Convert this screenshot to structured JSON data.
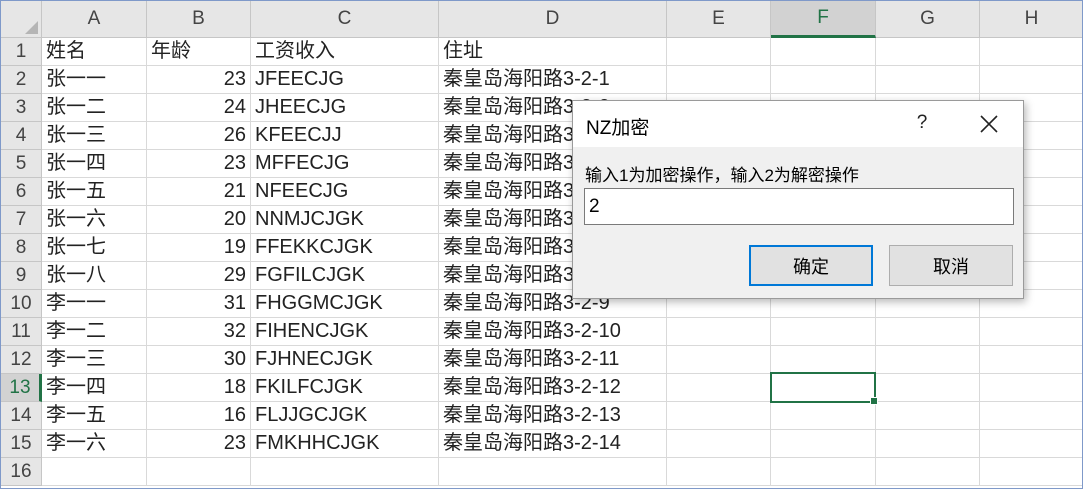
{
  "sheet": {
    "columns": [
      "A",
      "B",
      "C",
      "D",
      "E",
      "F",
      "G",
      "H"
    ],
    "selected_column": "F",
    "selected_row": "13",
    "rows": [
      {
        "num": "1",
        "cells": [
          "姓名",
          "年龄",
          "工资收入",
          "住址"
        ]
      },
      {
        "num": "2",
        "cells": [
          "张一一",
          "23",
          "JFEECJG",
          "秦皇岛海阳路3-2-1"
        ]
      },
      {
        "num": "3",
        "cells": [
          "张一二",
          "24",
          "JHEECJG",
          "秦皇岛海阳路3-2-2"
        ]
      },
      {
        "num": "4",
        "cells": [
          "张一三",
          "26",
          "KFEECJJ",
          "秦皇岛海阳路3-2-3"
        ]
      },
      {
        "num": "5",
        "cells": [
          "张一四",
          "23",
          "MFFECJG",
          "秦皇岛海阳路3-2-4"
        ]
      },
      {
        "num": "6",
        "cells": [
          "张一五",
          "21",
          "NFEECJG",
          "秦皇岛海阳路3-2-5"
        ]
      },
      {
        "num": "7",
        "cells": [
          "张一六",
          "20",
          "NNMJCJGK",
          "秦皇岛海阳路3-2-6"
        ]
      },
      {
        "num": "8",
        "cells": [
          "张一七",
          "19",
          "FFEKKCJGK",
          "秦皇岛海阳路3-2-7"
        ]
      },
      {
        "num": "9",
        "cells": [
          "张一八",
          "29",
          "FGFILCJGK",
          "秦皇岛海阳路3-2-8"
        ]
      },
      {
        "num": "10",
        "cells": [
          "李一一",
          "31",
          "FHGGMCJGK",
          "秦皇岛海阳路3-2-9"
        ]
      },
      {
        "num": "11",
        "cells": [
          "李一二",
          "32",
          "FIHENCJGK",
          "秦皇岛海阳路3-2-10"
        ]
      },
      {
        "num": "12",
        "cells": [
          "李一三",
          "30",
          "FJHNECJGK",
          "秦皇岛海阳路3-2-11"
        ]
      },
      {
        "num": "13",
        "cells": [
          "李一四",
          "18",
          "FKILFCJGK",
          "秦皇岛海阳路3-2-12"
        ]
      },
      {
        "num": "14",
        "cells": [
          "李一五",
          "16",
          "FLJJGCJGK",
          "秦皇岛海阳路3-2-13"
        ]
      },
      {
        "num": "15",
        "cells": [
          "李一六",
          "23",
          "FMKHHCJGK",
          "秦皇岛海阳路3-2-14"
        ]
      },
      {
        "num": "16",
        "cells": [
          "",
          "",
          "",
          ""
        ]
      }
    ]
  },
  "dialog": {
    "title": "NZ加密",
    "help": "?",
    "prompt": "输入1为加密操作，输入2为解密操作",
    "input_value": "2",
    "ok_label": "确定",
    "cancel_label": "取消",
    "close_icon": "close-icon"
  },
  "colors": {
    "accent": "#217346",
    "focus_border": "#0078d7",
    "header_bg": "#e6e6e6",
    "gridline": "#d9d9d9"
  }
}
